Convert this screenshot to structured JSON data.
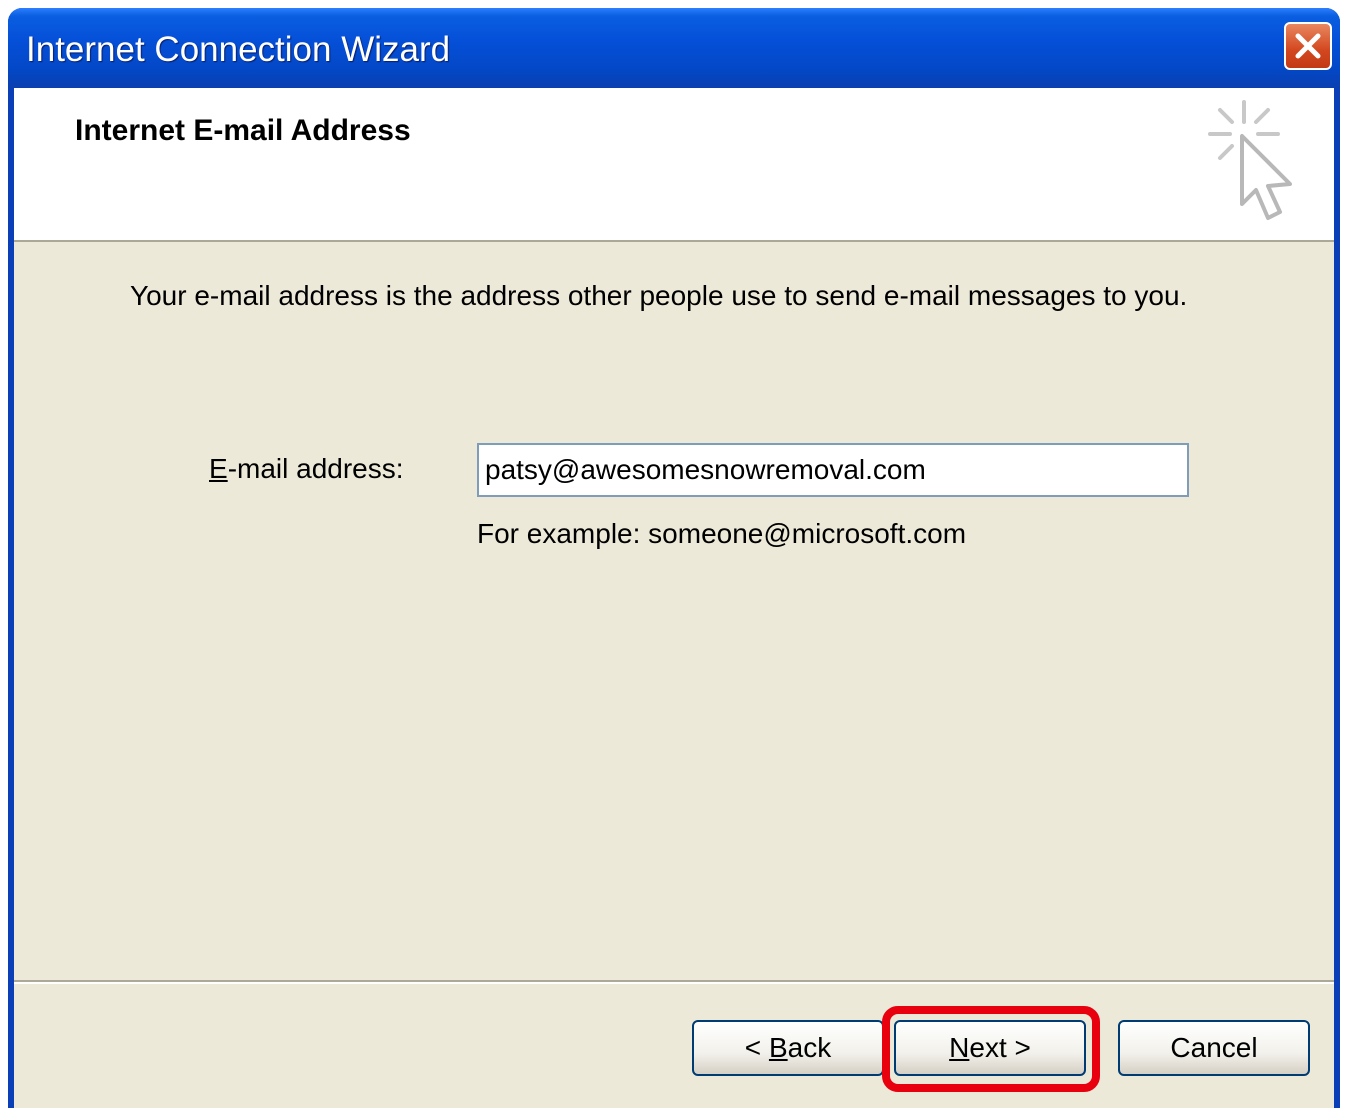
{
  "window": {
    "title": "Internet Connection Wizard"
  },
  "header": {
    "title": "Internet E-mail Address",
    "icon": "wizard-cursor-icon"
  },
  "main": {
    "description": "Your e-mail address is the address other people use to send e-mail messages to you.",
    "email_label_mnemonic": "E",
    "email_label_rest": "-mail address:",
    "email_value": "patsy@awesomesnowremoval.com",
    "example": "For example: someone@microsoft.com"
  },
  "buttons": {
    "back_prefix": "< ",
    "back_mnemonic": "B",
    "back_rest": "ack",
    "next_mnemonic": "N",
    "next_rest": "ext >",
    "cancel": "Cancel"
  },
  "colors": {
    "titlebar": "#0550d8",
    "client_bg": "#ece9d8",
    "close_button": "#d3471f",
    "highlight": "#e8000f"
  }
}
